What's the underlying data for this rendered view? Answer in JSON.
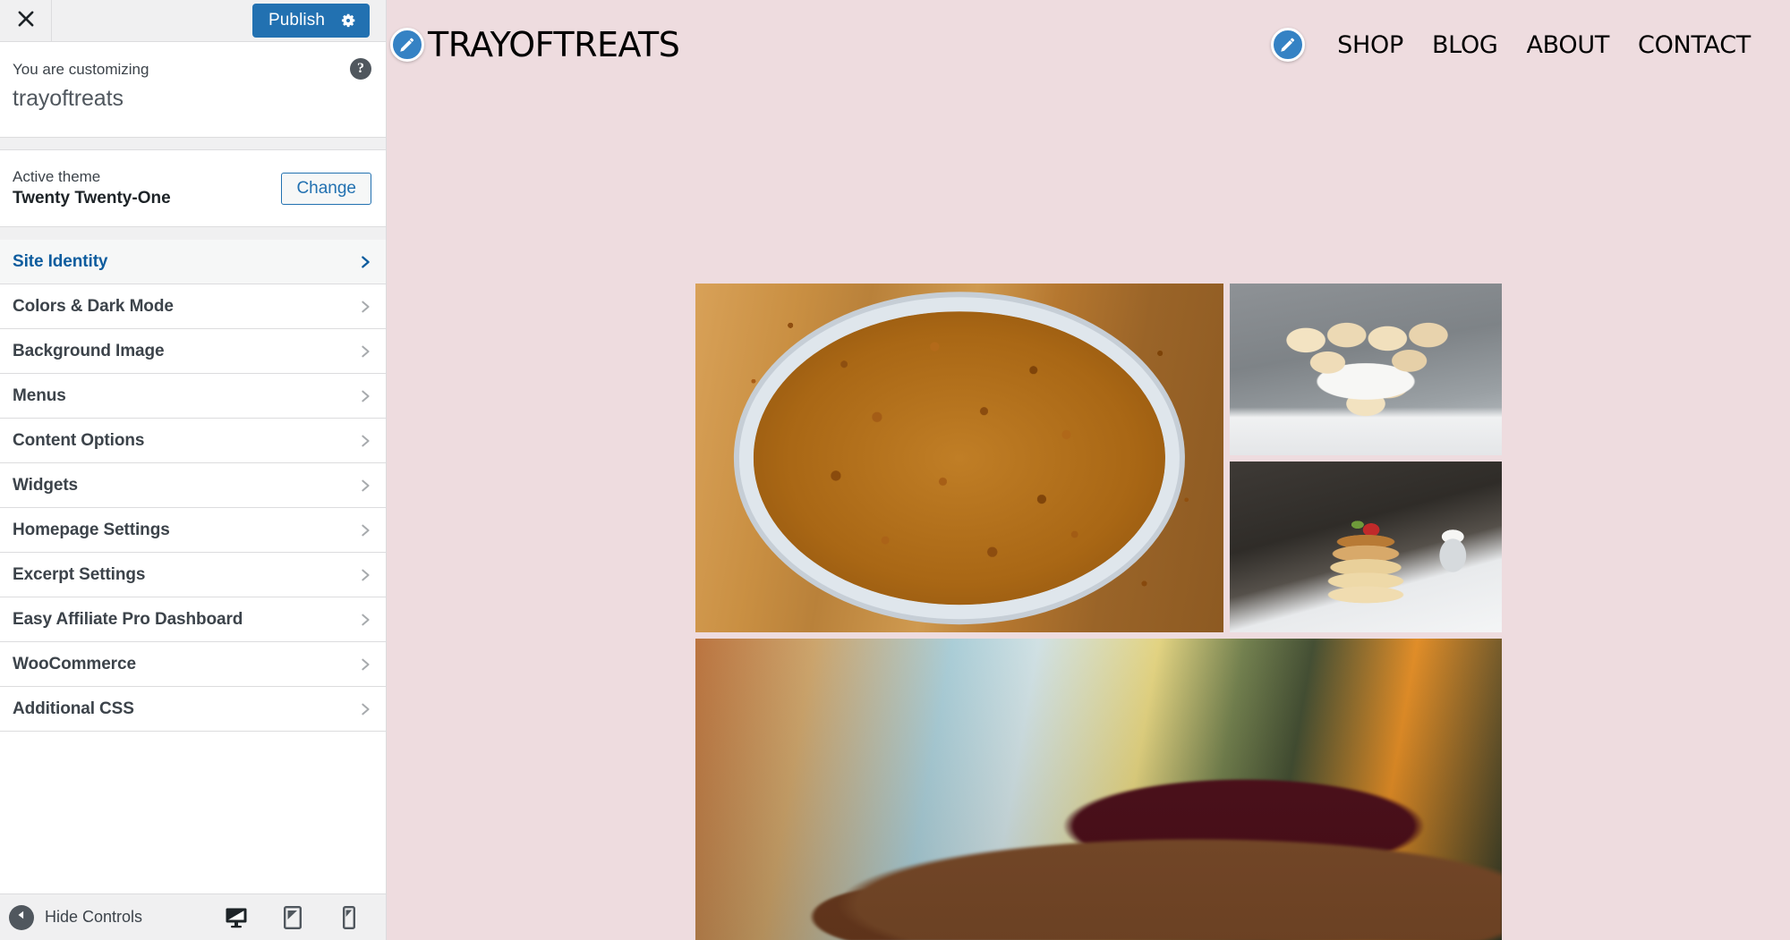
{
  "customizer": {
    "close_icon": "close-x-icon",
    "publish_label": "Publish",
    "publish_settings_icon": "gear-icon",
    "customizing_label": "You are customizing",
    "site_name": "trayoftreats",
    "help_icon": "question-mark-icon",
    "theme": {
      "active_theme_label": "Active theme",
      "theme_name": "Twenty Twenty-One",
      "change_label": "Change"
    },
    "panels": [
      {
        "label": "Site Identity",
        "active": true
      },
      {
        "label": "Colors & Dark Mode",
        "active": false
      },
      {
        "label": "Background Image",
        "active": false
      },
      {
        "label": "Menus",
        "active": false
      },
      {
        "label": "Content Options",
        "active": false
      },
      {
        "label": "Widgets",
        "active": false
      },
      {
        "label": "Homepage Settings",
        "active": false
      },
      {
        "label": "Excerpt Settings",
        "active": false
      },
      {
        "label": "Easy Affiliate Pro Dashboard",
        "active": false
      },
      {
        "label": "WooCommerce",
        "active": false
      },
      {
        "label": "Additional CSS",
        "active": false
      }
    ],
    "footer": {
      "collapse_icon": "collapse-left-arrow-icon",
      "hide_controls_label": "Hide Controls",
      "devices": [
        {
          "name": "desktop-preview-icon",
          "active": true
        },
        {
          "name": "tablet-preview-icon",
          "active": false
        },
        {
          "name": "mobile-preview-icon",
          "active": false
        }
      ]
    },
    "colors": {
      "publish_blue": "#2271b1",
      "link_blue": "#0d5c9e",
      "panel_bg": "#ffffff",
      "strip_bg": "#f0f0f1",
      "border": "#dcdcde"
    }
  },
  "preview": {
    "background_color": "#eedcdf",
    "site_title": "TRAYOFTREATS",
    "title_edit_icon": "pencil-edit-icon",
    "nav_edit_icon": "pencil-edit-icon",
    "nav_items": [
      {
        "label": "SHOP"
      },
      {
        "label": "BLOG"
      },
      {
        "label": "ABOUT"
      },
      {
        "label": "CONTACT"
      }
    ],
    "gallery": {
      "images": [
        {
          "alt": "Caramel nut pie in a metal tin on a wooden board",
          "position": "main-left"
        },
        {
          "alt": "Powdered sugar filled donuts on white plates",
          "position": "top-right"
        },
        {
          "alt": "Pancake stack with strawberry and caramel drizzle",
          "position": "mid-right"
        },
        {
          "alt": "Chocolate cherry cheesecake slice close-up",
          "position": "bottom-wide"
        }
      ]
    }
  }
}
